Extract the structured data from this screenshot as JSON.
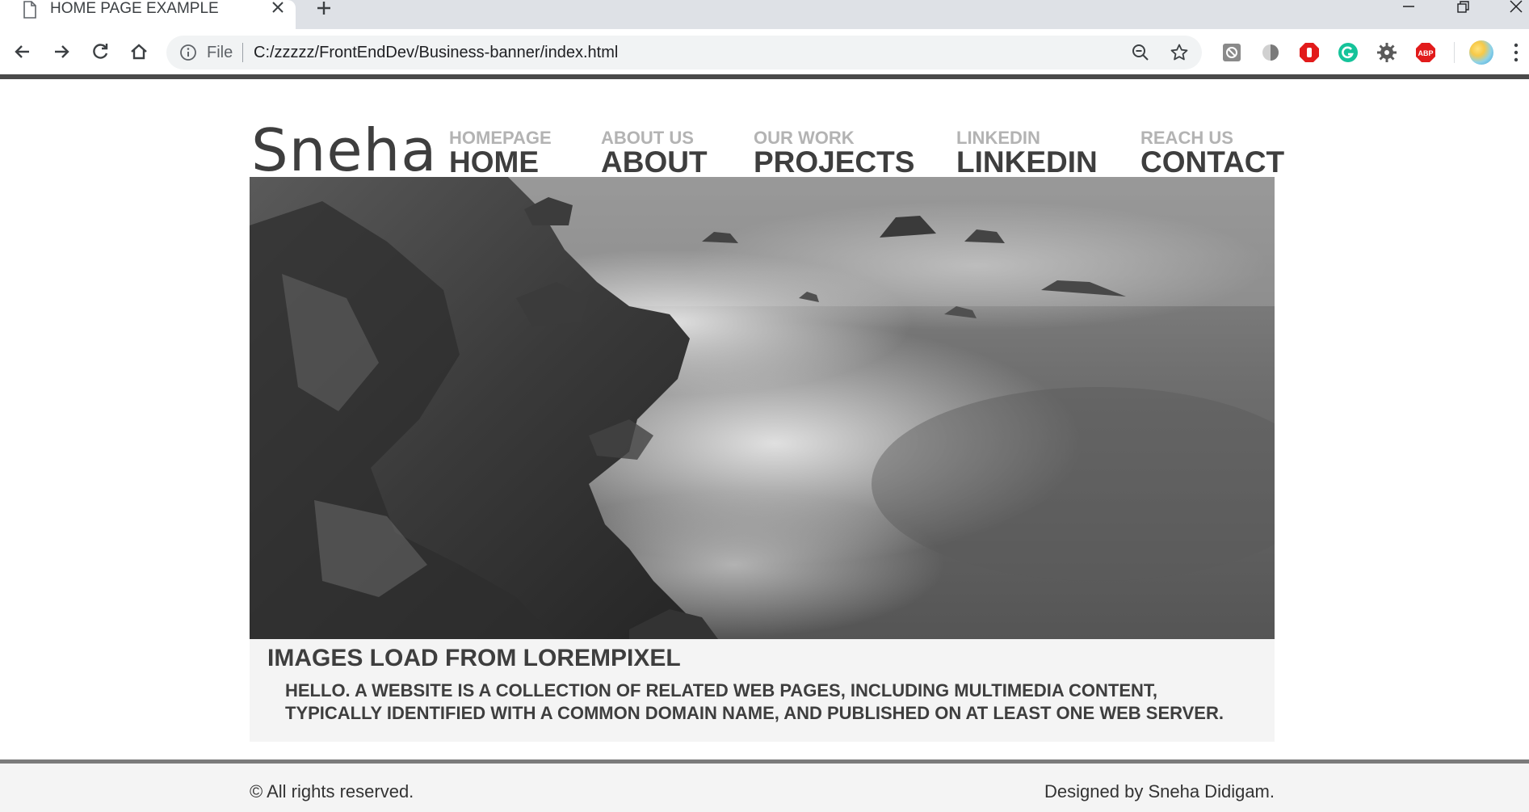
{
  "browser": {
    "tab_title": "HOME PAGE EXAMPLE",
    "omnibox_scheme": "File",
    "url": "C:/zzzzz/FrontEndDev/Business-banner/index.html",
    "extensions": [
      "ghostery-icon",
      "shade-icon",
      "stop-hand-icon",
      "grammarly-icon",
      "gear-extension-icon",
      "adblock-plus-icon"
    ],
    "extension_labels": {
      "adblock": "ABP"
    }
  },
  "site": {
    "logo": "Sneha",
    "nav": [
      {
        "small": "HOMEPAGE",
        "big": "HOME"
      },
      {
        "small": "ABOUT US",
        "big": "ABOUT"
      },
      {
        "small": "OUR WORK",
        "big": "PROJECTS"
      },
      {
        "small": "LINKEDIN",
        "big": "LINKEDIN"
      },
      {
        "small": "REACH US",
        "big": "CONTACT"
      }
    ],
    "caption": {
      "title": "IMAGES LOAD FROM LOREMPIXEL",
      "body": "HELLO. A WEBSITE IS A COLLECTION OF RELATED WEB PAGES, INCLUDING MULTIMEDIA CONTENT, TYPICALLY IDENTIFIED WITH A COMMON DOMAIN NAME, AND PUBLISHED ON AT LEAST ONE WEB SERVER."
    },
    "footer": {
      "left": "© All rights reserved.",
      "right": "Designed by Sneha Didigam."
    }
  },
  "colors": {
    "nav_small": "#b3b3b3",
    "nav_big": "#3e3e3e",
    "caption_bg": "#f4f4f4",
    "chrome_tabstrip": "#dee1e6",
    "omnibox_bg": "#f1f3f4"
  }
}
